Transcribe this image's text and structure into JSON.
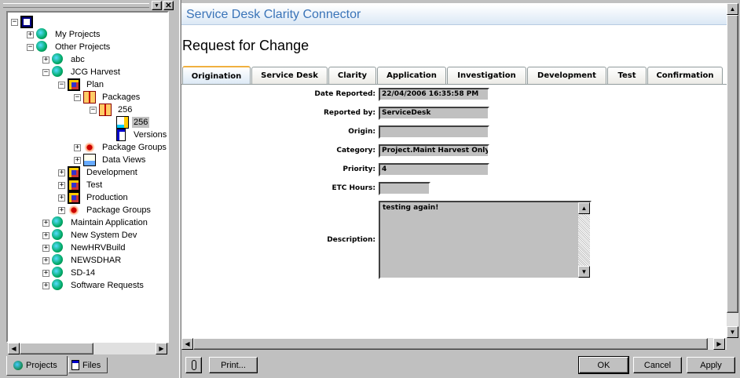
{
  "left_panel": {
    "tree": [
      {
        "label": "",
        "level": 0,
        "toggle": "minus",
        "icon": "computer"
      },
      {
        "label": "My Projects",
        "level": 1,
        "toggle": "plus",
        "icon": "globe"
      },
      {
        "label": "Other Projects",
        "level": 1,
        "toggle": "minus",
        "icon": "globe"
      },
      {
        "label": "abc",
        "level": 2,
        "toggle": "plus",
        "icon": "globe"
      },
      {
        "label": "JCG Harvest",
        "level": 2,
        "toggle": "minus",
        "icon": "globe"
      },
      {
        "label": "Plan",
        "level": 3,
        "toggle": "minus",
        "icon": "cube"
      },
      {
        "label": "Packages",
        "level": 4,
        "toggle": "minus",
        "icon": "package"
      },
      {
        "label": "256",
        "level": 5,
        "toggle": "minus",
        "icon": "package"
      },
      {
        "label": "256",
        "level": 6,
        "toggle": "none",
        "icon": "form",
        "selected": true
      },
      {
        "label": "Versions",
        "level": 6,
        "toggle": "none",
        "icon": "document"
      },
      {
        "label": "Package Groups",
        "level": 4,
        "toggle": "plus",
        "icon": "package-group"
      },
      {
        "label": "Data Views",
        "level": 4,
        "toggle": "plus",
        "icon": "data-view"
      },
      {
        "label": "Development",
        "level": 3,
        "toggle": "plus",
        "icon": "cube"
      },
      {
        "label": "Test",
        "level": 3,
        "toggle": "plus",
        "icon": "cube"
      },
      {
        "label": "Production",
        "level": 3,
        "toggle": "plus",
        "icon": "cube"
      },
      {
        "label": "Package Groups",
        "level": 3,
        "toggle": "plus",
        "icon": "package-group"
      },
      {
        "label": "Maintain Application",
        "level": 2,
        "toggle": "plus",
        "icon": "globe"
      },
      {
        "label": "New System Dev",
        "level": 2,
        "toggle": "plus",
        "icon": "globe"
      },
      {
        "label": "NewHRVBuild",
        "level": 2,
        "toggle": "plus",
        "icon": "globe"
      },
      {
        "label": "NEWSDHAR",
        "level": 2,
        "toggle": "plus",
        "icon": "globe"
      },
      {
        "label": "SD-14",
        "level": 2,
        "toggle": "plus",
        "icon": "globe"
      },
      {
        "label": "Software Requests",
        "level": 2,
        "toggle": "plus",
        "icon": "globe"
      }
    ],
    "tabs": [
      {
        "label": "Projects",
        "icon": "globe",
        "active": true
      },
      {
        "label": "Files",
        "icon": "document"
      }
    ]
  },
  "main": {
    "header_title": "Service Desk Clarity Connector",
    "form_title": "Request for Change",
    "tabs": [
      "Origination",
      "Service Desk",
      "Clarity",
      "Application",
      "Investigation",
      "Development",
      "Test",
      "Confirmation"
    ],
    "active_tab": "Origination",
    "fields": [
      {
        "label": "Date Reported:",
        "value": "22/04/2006 16:35:58 PM"
      },
      {
        "label": "Reported by:",
        "value": "ServiceDesk"
      },
      {
        "label": "Origin:",
        "value": ""
      },
      {
        "label": "Category:",
        "value": "Project.Maint Harvest Only"
      },
      {
        "label": "Priority:",
        "value": "4"
      },
      {
        "label": "ETC Hours:",
        "value": ""
      }
    ],
    "description": {
      "label": "Description:",
      "value": "testing again!"
    }
  },
  "buttons": {
    "print": "Print...",
    "ok": "OK",
    "cancel": "Cancel",
    "apply": "Apply"
  },
  "colors": {
    "header_text": "#3a74b8",
    "active_tab_accent": "#f0b040",
    "field_bg": "#c0c0c0"
  }
}
